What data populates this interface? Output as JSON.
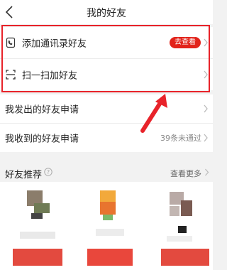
{
  "header": {
    "title": "我的好友"
  },
  "rows": {
    "contacts": {
      "label": "添加通讯录好友",
      "badge": "去查看"
    },
    "scan": {
      "label": "扫一扫加好友"
    },
    "sent": {
      "label": "我发出的好友申请"
    },
    "received": {
      "label": "我收到的好友申请",
      "status": "39条未通过"
    }
  },
  "recommend": {
    "title": "好友推荐",
    "more": "查看更多"
  },
  "colors": {
    "accent": "#e2231a",
    "annotation": "#e8232a"
  },
  "icons": [
    "back-icon",
    "contacts-book-icon",
    "scan-icon",
    "chevron-right-icon",
    "help-icon",
    "annotation-arrow"
  ]
}
